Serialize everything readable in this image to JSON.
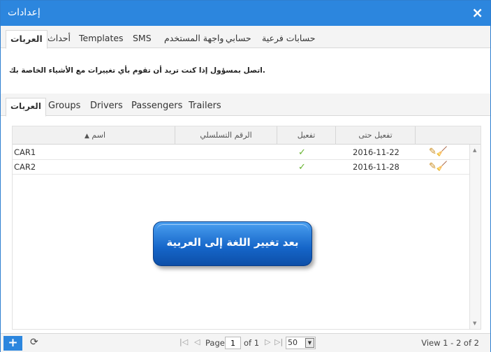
{
  "window": {
    "title": "إعدادات",
    "close_label": "×"
  },
  "tabs": [
    {
      "label": "حسابات فرعية"
    },
    {
      "label": "حسابي"
    },
    {
      "label": "واجهة المستخدم"
    },
    {
      "label": "SMS"
    },
    {
      "label": "Templates"
    },
    {
      "label": "أحداث"
    },
    {
      "label": "العربات",
      "active": true
    }
  ],
  "info_text": "اتصل بمسؤول إذا كنت تريد أن تقوم بأي تغييرات مع الأشياء الخاصة بك.",
  "subtabs": [
    {
      "label": "العربات",
      "active": true
    },
    {
      "label": "Groups"
    },
    {
      "label": "Drivers"
    },
    {
      "label": "Passengers"
    },
    {
      "label": "Trailers"
    }
  ],
  "grid": {
    "columns": {
      "name": "اسم",
      "serial": "الرقم التسلسلي",
      "active": "تفعيل",
      "active_until": "تفعيل حتى"
    },
    "rows": [
      {
        "name": "CAR1",
        "serial": "",
        "active": "✓",
        "active_until": "2016-11-22"
      },
      {
        "name": "CAR2",
        "serial": "",
        "active": "✓",
        "active_until": "2016-11-28"
      }
    ]
  },
  "callout": "بعد تغيير اللغة إلى العربية",
  "pager": {
    "add_label": "+",
    "page_label": "Page",
    "page_value": "1",
    "of_label": "of 1",
    "page_size": "50",
    "view_text": "View 1 - 2 of 2"
  },
  "icons": {
    "close": "close-icon",
    "add": "plus-icon",
    "refresh": "refresh-icon",
    "edit": "pencil-icon",
    "clear": "broom-icon",
    "check": "check-icon"
  },
  "colors": {
    "titlebar": "#2c86de",
    "check": "#66b32e",
    "callout": "#1565c8"
  }
}
